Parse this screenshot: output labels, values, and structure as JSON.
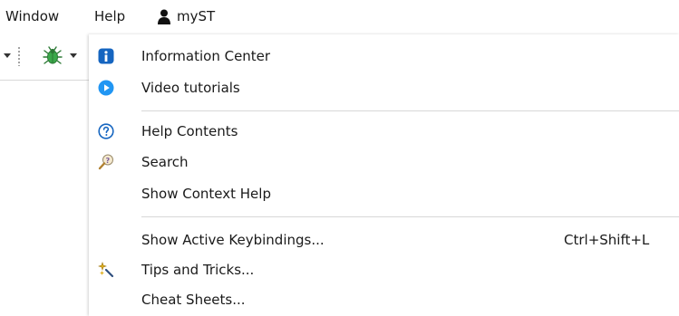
{
  "menubar": {
    "window_label": "Window",
    "help_label": "Help",
    "account_label": "myST"
  },
  "help_menu": {
    "groups": [
      {
        "items": [
          {
            "label": "Information Center",
            "icon": "info-icon"
          },
          {
            "label": "Video tutorials",
            "icon": "play-icon"
          }
        ]
      },
      {
        "items": [
          {
            "label": "Help Contents",
            "icon": "help-contents-icon"
          },
          {
            "label": "Search",
            "icon": "search-help-icon"
          },
          {
            "label": "Show Context Help",
            "icon": ""
          }
        ]
      },
      {
        "items": [
          {
            "label": "Show Active Keybindings...",
            "icon": "",
            "shortcut": "Ctrl+Shift+L"
          },
          {
            "label": "Tips and Tricks...",
            "icon": "tips-icon"
          },
          {
            "label": "Cheat Sheets...",
            "icon": ""
          }
        ]
      }
    ]
  },
  "colors": {
    "info_blue": "#1565c0",
    "play_blue": "#2196f3",
    "separator": "#d8d8d8",
    "bug_green": "#3aa84a"
  }
}
